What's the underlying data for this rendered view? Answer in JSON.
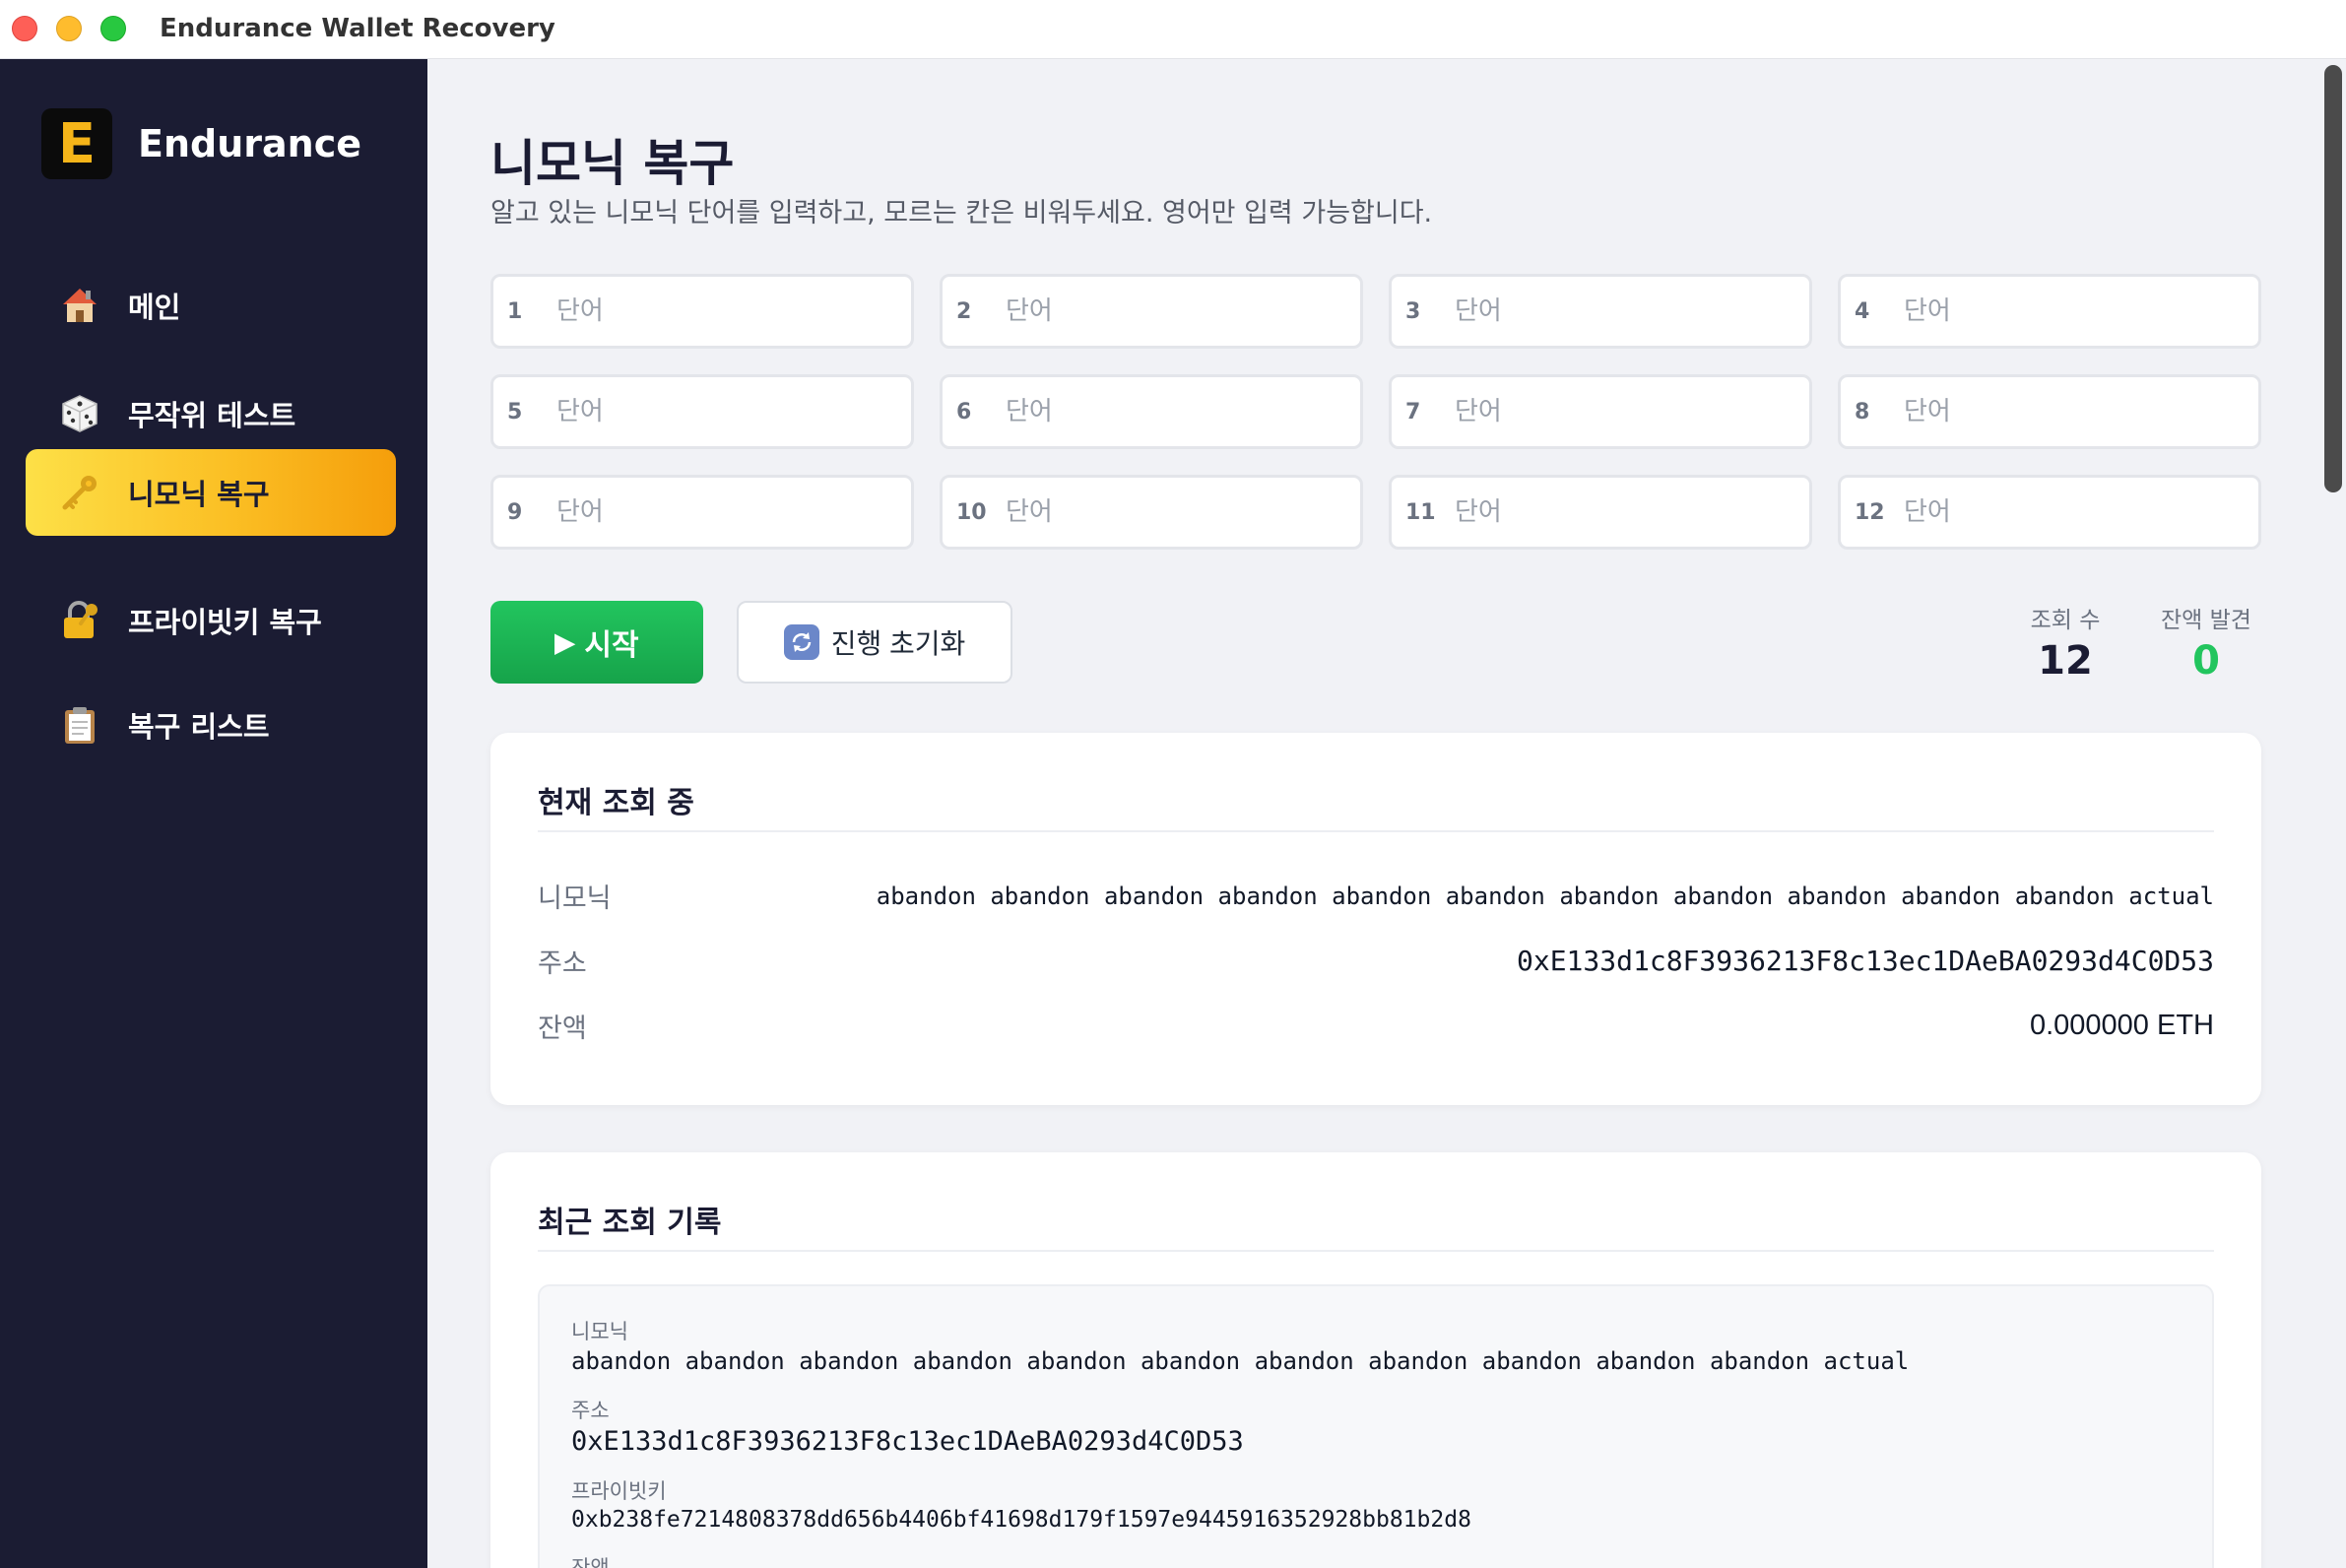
{
  "window": {
    "title": "Endurance Wallet Recovery"
  },
  "sidebar": {
    "logo_letter": "E",
    "brand": "Endurance",
    "items": [
      {
        "label": "메인",
        "icon": "house-icon",
        "emoji": "🏠",
        "active": false
      },
      {
        "label": "무작위 테스트",
        "icon": "dice-icon",
        "emoji": "🎲",
        "active": false
      },
      {
        "label": "니모닉 복구",
        "icon": "key-icon",
        "emoji": "🔑",
        "active": true
      },
      {
        "label": "프라이빗키 복구",
        "icon": "lock-key-icon",
        "emoji": "🔐",
        "active": false
      },
      {
        "label": "복구 리스트",
        "icon": "clipboard-icon",
        "emoji": "📋",
        "active": false
      }
    ]
  },
  "main": {
    "title": "니모닉 복구",
    "subtitle": "알고 있는 니모닉 단어를 입력하고, 모르는 칸은 비워두세요. 영어만 입력 가능합니다.",
    "words": [
      {
        "num": "1",
        "placeholder": "단어",
        "value": ""
      },
      {
        "num": "2",
        "placeholder": "단어",
        "value": ""
      },
      {
        "num": "3",
        "placeholder": "단어",
        "value": ""
      },
      {
        "num": "4",
        "placeholder": "단어",
        "value": ""
      },
      {
        "num": "5",
        "placeholder": "단어",
        "value": ""
      },
      {
        "num": "6",
        "placeholder": "단어",
        "value": ""
      },
      {
        "num": "7",
        "placeholder": "단어",
        "value": ""
      },
      {
        "num": "8",
        "placeholder": "단어",
        "value": ""
      },
      {
        "num": "9",
        "placeholder": "단어",
        "value": ""
      },
      {
        "num": "10",
        "placeholder": "단어",
        "value": ""
      },
      {
        "num": "11",
        "placeholder": "단어",
        "value": ""
      },
      {
        "num": "12",
        "placeholder": "단어",
        "value": ""
      }
    ],
    "start_button": {
      "icon": "▶",
      "label": "시작"
    },
    "reset_button": {
      "icon": "🔄",
      "label": "진행 초기화"
    },
    "stats": {
      "lookups_label": "조회 수",
      "lookups_value": "12",
      "found_label": "잔액 발견",
      "found_value": "0"
    },
    "current": {
      "title": "현재 조회 중",
      "mnemonic_label": "니모닉",
      "mnemonic_value": "abandon abandon abandon abandon abandon abandon abandon abandon abandon abandon abandon actual",
      "address_label": "주소",
      "address_value": "0xE133d1c8F3936213F8c13ec1DAeBA0293d4C0D53",
      "balance_label": "잔액",
      "balance_value": "0.000000 ETH"
    },
    "recent": {
      "title": "최근 조회 기록",
      "records": [
        {
          "mnemonic_label": "니모닉",
          "mnemonic": "abandon abandon abandon abandon abandon abandon abandon abandon abandon abandon abandon actual",
          "address_label": "주소",
          "address": "0xE133d1c8F3936213F8c13ec1DAeBA0293d4C0D53",
          "private_key_label": "프라이빗키",
          "private_key": "0xb238fe7214808378dd656b4406bf41698d179f1597e9445916352928bb81b2d8",
          "balance_label": "잔액"
        }
      ]
    }
  },
  "colors": {
    "sidebar_bg": "#1b1c33",
    "active_gradient_start": "#fde047",
    "active_gradient_end": "#f59e0b",
    "start_green": "#22c55e",
    "found_green": "#22c55e",
    "brand_yellow": "#f6b519"
  }
}
